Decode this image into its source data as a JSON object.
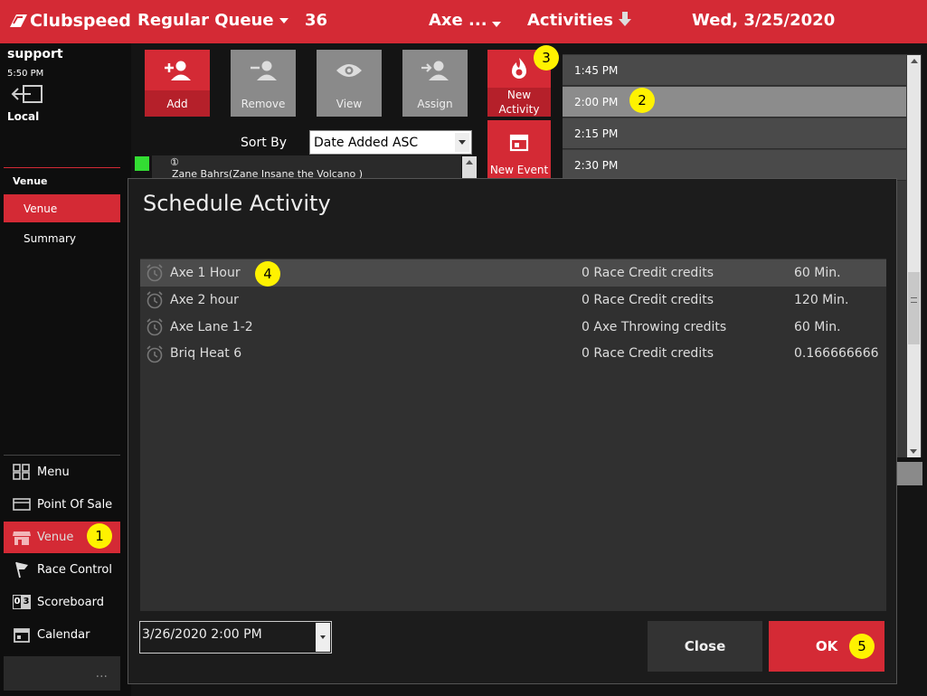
{
  "header": {
    "brand": "Clubspeed",
    "queue": "Regular Queue",
    "queue_count": "36",
    "track": "Axe ...",
    "mode": "Activities",
    "date": "Wed, 3/25/2020"
  },
  "user": {
    "name": "support",
    "time": "5:50 PM",
    "location": "Local"
  },
  "sidebar": {
    "section_title": "Venue",
    "section_items": [
      {
        "label": "Venue"
      },
      {
        "label": "Summary"
      }
    ],
    "bottom_items": [
      {
        "label": "Menu"
      },
      {
        "label": "Point Of Sale"
      },
      {
        "label": "Venue"
      },
      {
        "label": "Race Control"
      },
      {
        "label": "Scoreboard"
      },
      {
        "label": "Calendar"
      }
    ],
    "more": "..."
  },
  "toolbar": {
    "buttons": [
      {
        "label": "Add"
      },
      {
        "label": "Remove"
      },
      {
        "label": "View"
      },
      {
        "label": "Assign"
      }
    ],
    "new_activity_line1": "New",
    "new_activity_line2": "Activity",
    "new_event": "New Event",
    "sort_label": "Sort By",
    "sort_value": "Date Added ASC"
  },
  "queue_list": [
    {
      "text": "Zane Bahrs(Zane Insane the Volcano )"
    }
  ],
  "schedule": {
    "slots": [
      {
        "time": "1:45 PM"
      },
      {
        "time": "2:00 PM"
      },
      {
        "time": "2:15 PM"
      },
      {
        "time": "2:30 PM"
      }
    ]
  },
  "modal": {
    "title": "Schedule Activity",
    "rows": [
      {
        "name": "Axe 1 Hour",
        "credits": "0 Race Credit credits",
        "duration": "60 Min."
      },
      {
        "name": "Axe 2 hour",
        "credits": "0 Race Credit credits",
        "duration": "120 Min."
      },
      {
        "name": "Axe Lane 1-2",
        "credits": "0 Axe Throwing credits",
        "duration": "60 Min."
      },
      {
        "name": "Briq Heat 6",
        "credits": "0 Race Credit credits",
        "duration": "0.166666666"
      }
    ],
    "datetime": "3/26/2020 2:00 PM",
    "close_label": "Close",
    "ok_label": "OK"
  },
  "markers": [
    "1",
    "2",
    "3",
    "4",
    "5"
  ],
  "colors": {
    "accent": "#d42a35",
    "marker": "#fff200",
    "active_green": "#33dd33"
  }
}
